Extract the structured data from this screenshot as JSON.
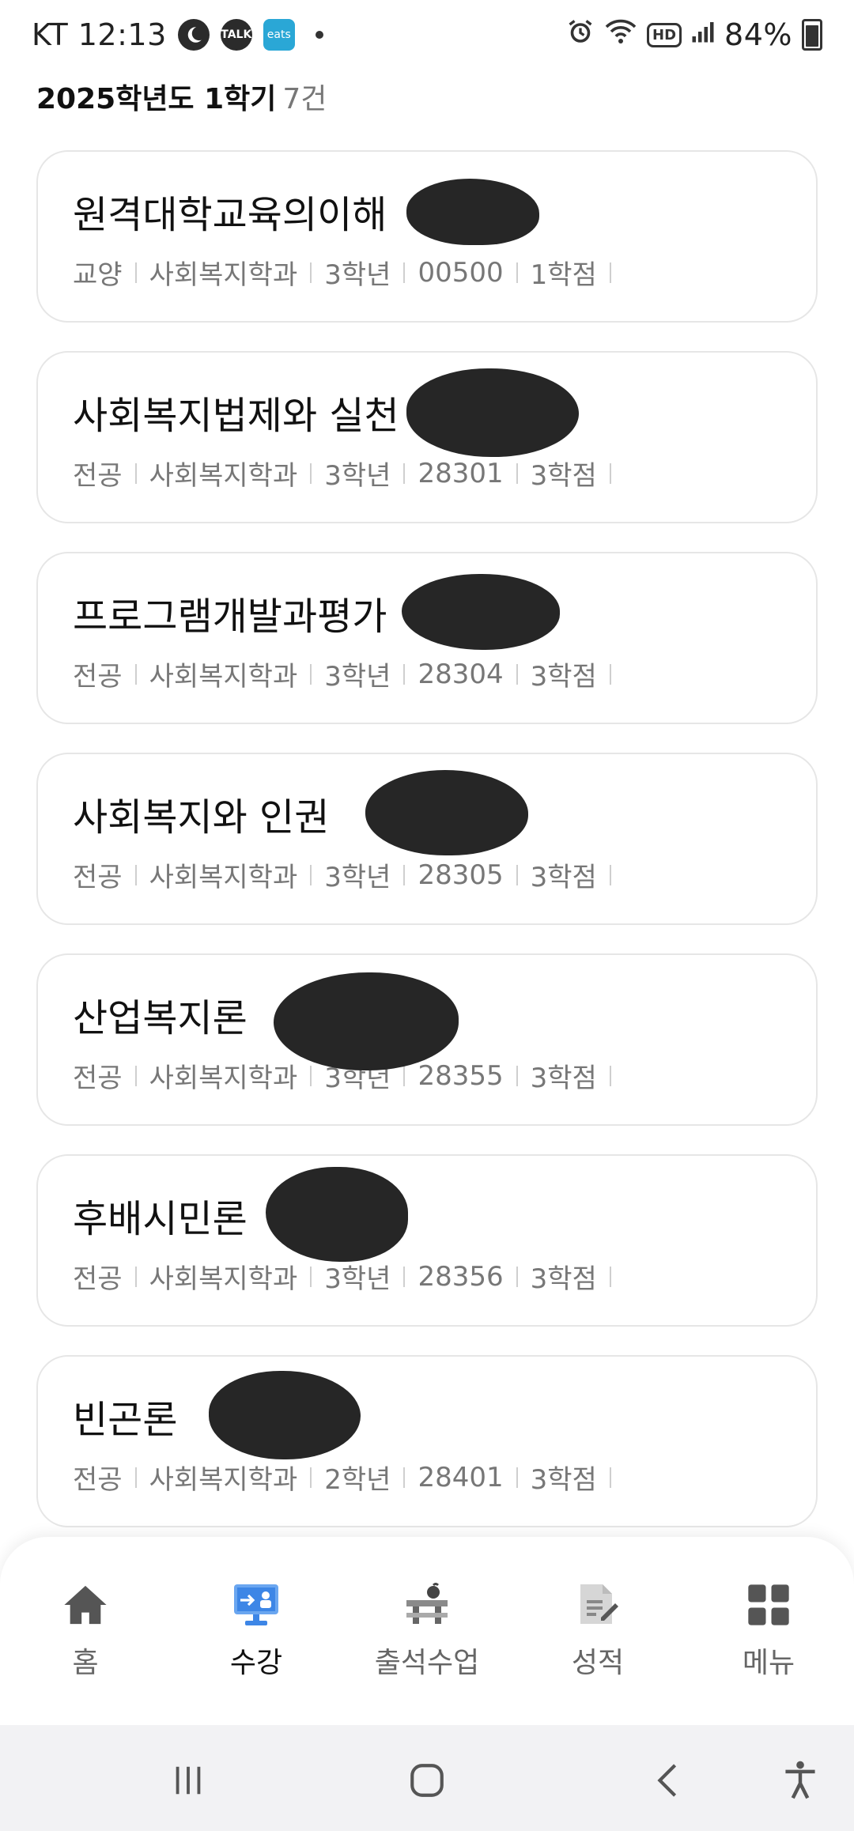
{
  "status_bar": {
    "carrier_time": "KT 12:13",
    "talk_label": "TALK",
    "eats_label": "eats",
    "battery": "84%"
  },
  "header": {
    "semester": "2025학년도 1학기",
    "count": "7건"
  },
  "courses": [
    {
      "title": "원격대학교육의이해",
      "type": "교양",
      "dept": "사회복지학과",
      "year": "3학년",
      "code": "00500",
      "credits": "1학점"
    },
    {
      "title": "사회복지법제와 실천",
      "type": "전공",
      "dept": "사회복지학과",
      "year": "3학년",
      "code": "28301",
      "credits": "3학점"
    },
    {
      "title": "프로그램개발과평가",
      "type": "전공",
      "dept": "사회복지학과",
      "year": "3학년",
      "code": "28304",
      "credits": "3학점"
    },
    {
      "title": "사회복지와 인권",
      "type": "전공",
      "dept": "사회복지학과",
      "year": "3학년",
      "code": "28305",
      "credits": "3학점"
    },
    {
      "title": "산업복지론",
      "type": "전공",
      "dept": "사회복지학과",
      "year": "3학년",
      "code": "28355",
      "credits": "3학점"
    },
    {
      "title": "후배시민론",
      "type": "전공",
      "dept": "사회복지학과",
      "year": "3학년",
      "code": "28356",
      "credits": "3학점"
    },
    {
      "title": "빈곤론",
      "type": "전공",
      "dept": "사회복지학과",
      "year": "2학년",
      "code": "28401",
      "credits": "3학점"
    }
  ],
  "bottom_nav": {
    "items": [
      {
        "label": "홈",
        "icon": "home-icon"
      },
      {
        "label": "수강",
        "icon": "lecture-monitor-icon",
        "active": true
      },
      {
        "label": "출석수업",
        "icon": "desk-icon"
      },
      {
        "label": "성적",
        "icon": "grade-document-icon"
      },
      {
        "label": "메뉴",
        "icon": "grid-menu-icon"
      }
    ]
  },
  "colors": {
    "accent_blue": "#3d86e6",
    "redaction": "#262626",
    "card_border": "#e6e6e6"
  }
}
